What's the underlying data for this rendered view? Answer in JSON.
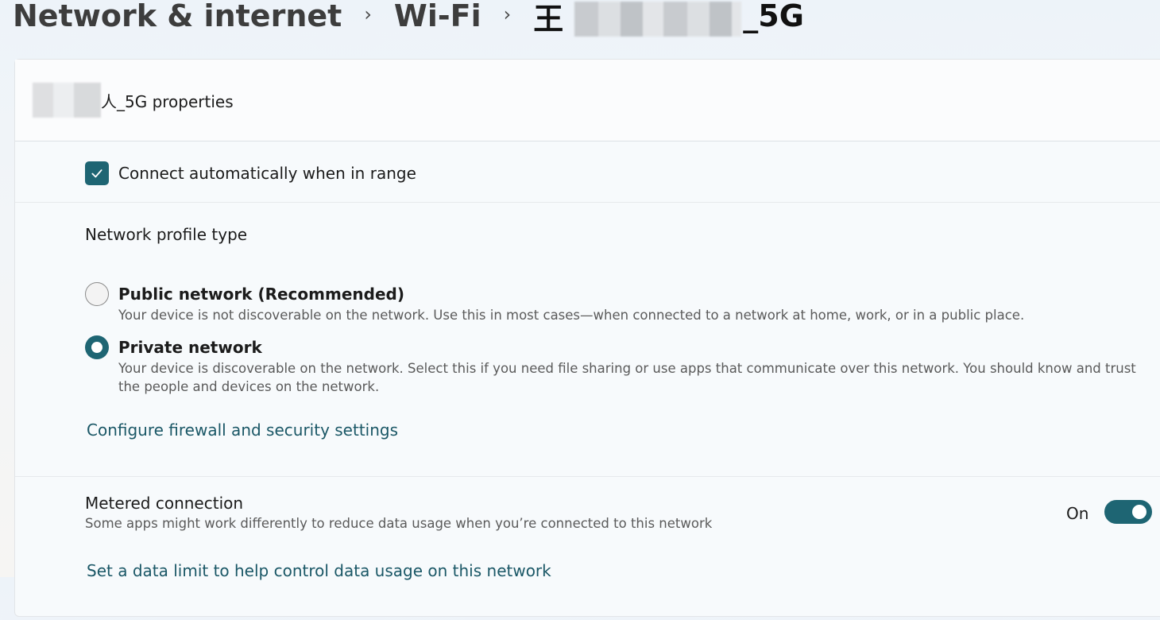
{
  "breadcrumb": {
    "level1": "Network & internet",
    "level2": "Wi-Fi",
    "current_prefix": "王",
    "current_suffix": "_5G"
  },
  "card": {
    "header_suffix": "人_5G properties"
  },
  "auto_connect": {
    "label": "Connect automatically when in range",
    "checked": true
  },
  "profile": {
    "title": "Network profile type",
    "public": {
      "title": "Public network (Recommended)",
      "desc": "Your device is not discoverable on the network. Use this in most cases—when connected to a network at home, work, or in a public place.",
      "selected": false
    },
    "private": {
      "title": "Private network",
      "desc": "Your device is discoverable on the network. Select this if you need file sharing or use apps that communicate over this network. You should know and trust the people and devices on the network.",
      "selected": true
    },
    "firewall_link": "Configure firewall and security settings"
  },
  "metered": {
    "title": "Metered connection",
    "desc": "Some apps might work differently to reduce data usage when you’re connected to this network",
    "state_label": "On",
    "on": true,
    "data_limit_link": "Set a data limit to help control data usage on this network"
  },
  "colors": {
    "accent": "#1e6573",
    "link": "#1a5766"
  }
}
